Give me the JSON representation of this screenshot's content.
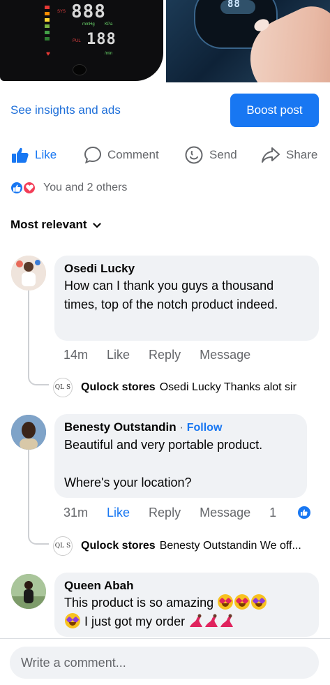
{
  "media": {
    "left_image": "blood-pressure-monitor-photo",
    "right_image": "finger-pressing-device-photo",
    "display_left": "888",
    "display_left_2": "188",
    "display_unit": "mmHg",
    "display_kpa": "KPa",
    "display_pul": "PUL",
    "display_bpm": "/min",
    "display_right": "88",
    "legend_mmhg": "mmHg",
    "legend_sys": "SYS"
  },
  "post": {
    "insights_label": "See insights and ads",
    "boost_label": "Boost post"
  },
  "actions": {
    "like": "Like",
    "comment": "Comment",
    "send": "Send",
    "share": "Share"
  },
  "reactions": {
    "summary": "You and 2 others"
  },
  "sort": {
    "label": "Most relevant"
  },
  "comments": [
    {
      "name": "Osedi Lucky",
      "text": "How can I thank you guys a thousand times, top of the notch product indeed.",
      "time": "14m",
      "like": "Like",
      "reply": "Reply",
      "message": "Message",
      "reply_preview": {
        "avatar_text": "QL S",
        "name": "Qulock stores",
        "text": "Osedi Lucky Thanks alot sir"
      }
    },
    {
      "name": "Benesty Outstandin",
      "follow": "Follow",
      "follow_sep": "·",
      "text": "Beautiful and very portable product.",
      "text2": "Where's your location?",
      "time": "31m",
      "like": "Like",
      "reply": "Reply",
      "message": "Message",
      "like_count": "1",
      "reply_preview": {
        "avatar_text": "QL S",
        "name": "Qulock stores",
        "text": "Benesty Outstandin We off..."
      }
    },
    {
      "name": "Queen Abah",
      "text_a": "This product is so amazing",
      "text_b": "I just got my order"
    }
  ],
  "composer": {
    "placeholder": "Write a comment..."
  },
  "colors": {
    "accent": "#1877f2",
    "bubble": "#f0f2f5",
    "secondary_text": "#65676b",
    "love": "#f33e58"
  }
}
